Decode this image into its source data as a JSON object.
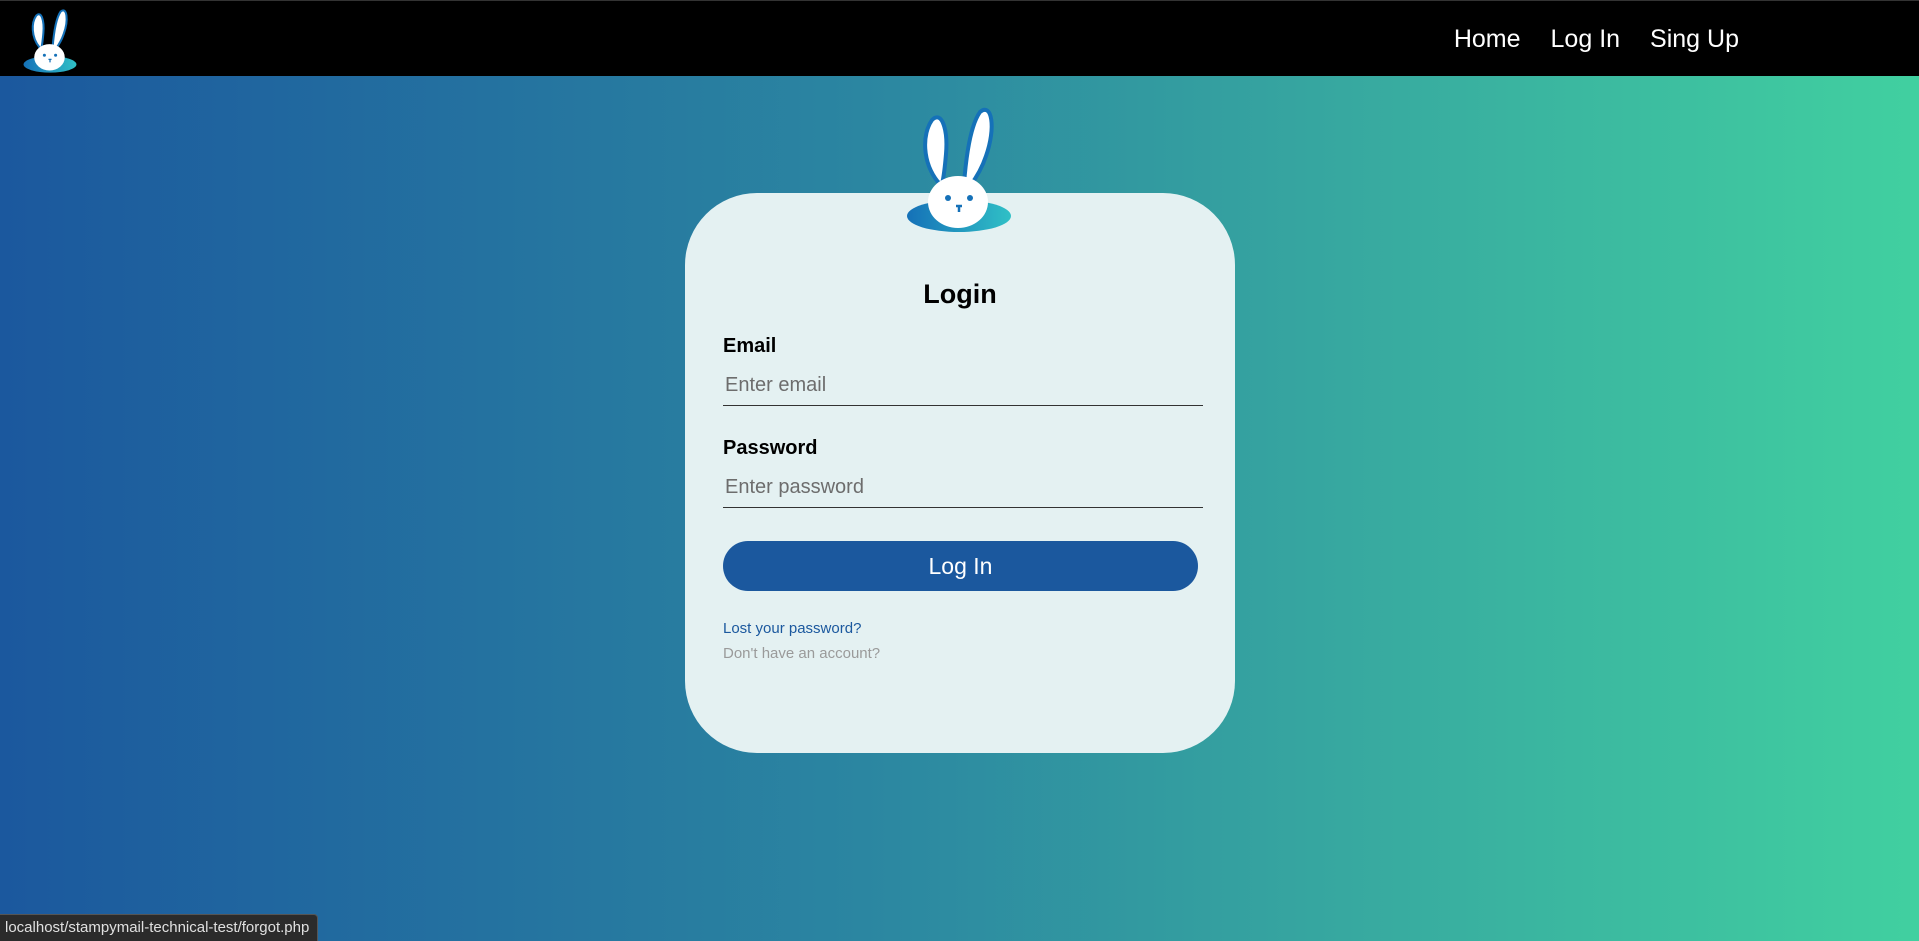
{
  "nav": {
    "logo_icon": "bunny-logo-icon",
    "links": [
      {
        "label": "Home"
      },
      {
        "label": "Log In"
      },
      {
        "label": "Sing Up"
      }
    ]
  },
  "login": {
    "title": "Login",
    "email_label": "Email",
    "email_placeholder": "Enter email",
    "email_value": "",
    "password_label": "Password",
    "password_placeholder": "Enter password",
    "password_value": "",
    "submit_label": "Log In",
    "forgot_label": "Lost your password?",
    "signup_label": "Don't have an account?"
  },
  "status_bar": {
    "url": "localhost/stampymail-technical-test/forgot.php"
  },
  "colors": {
    "accent": "#1b589e",
    "gradient_start": "#1b589e",
    "gradient_end": "#41d0a0",
    "card_bg": "#e4f1f2",
    "navbar_bg": "#000000"
  }
}
